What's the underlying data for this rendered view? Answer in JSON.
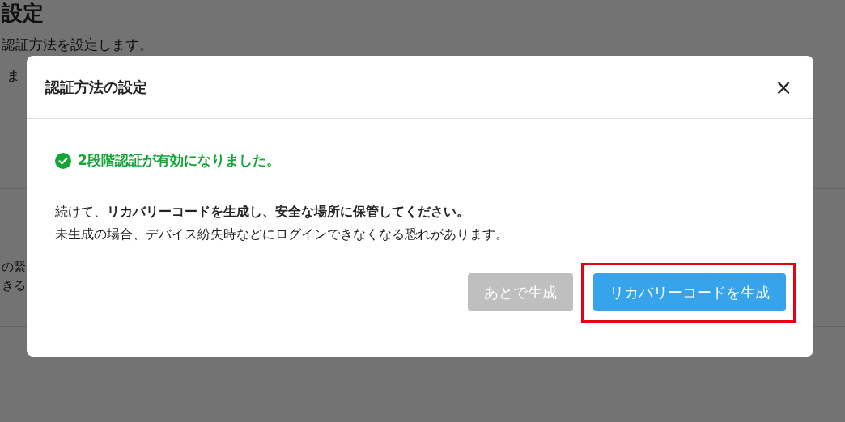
{
  "background_page": {
    "heading": "設定",
    "description": "認証方法を設定します。",
    "line_2": "ま",
    "item_text_1": "の緊",
    "item_text_2": "きる"
  },
  "dialog": {
    "title": "認証方法の設定",
    "close": "×",
    "success_message": "2段階認証が有効になりました。",
    "body": [
      "続けて、**リカバリーコードを生成し、安全な場所に保管してください。**",
      "未生成の場合、デバイス紛失時などにログインできなくなる恐れがあります。"
    ],
    "buttons": [
      {
        "label": "あとで生成",
        "kind": "secondary",
        "highlighted": false
      },
      {
        "label": "リカバリーコードを生成",
        "kind": "primary",
        "highlighted": true
      }
    ]
  }
}
